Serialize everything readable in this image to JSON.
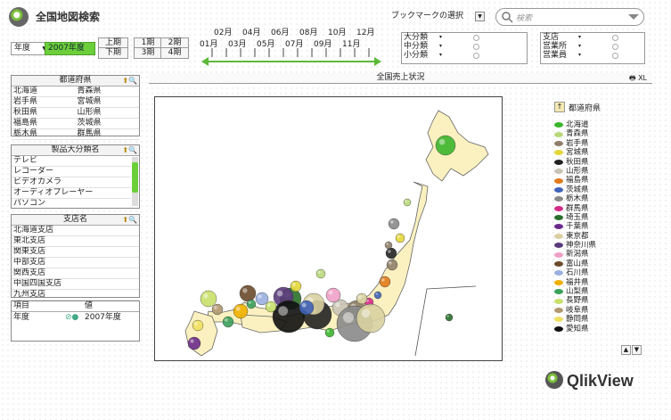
{
  "app": {
    "title": "全国地図検索",
    "bookmark_label": "ブックマークの選択",
    "search_placeholder": "検索",
    "brand": "QlikView"
  },
  "period": {
    "year_label": "年度",
    "year_value": "2007年度",
    "half_upper": "上期",
    "half_lower": "下期",
    "q1": "1期",
    "q2": "2期",
    "q3": "3期",
    "q4": "4期",
    "months_top": [
      "02月",
      "04月",
      "06月",
      "08月",
      "10月",
      "12月"
    ],
    "months_bottom": [
      "01月",
      "03月",
      "05月",
      "07月",
      "09月",
      "11月"
    ]
  },
  "filters_left": [
    {
      "label": "大分類"
    },
    {
      "label": "中分類"
    },
    {
      "label": "小分類"
    }
  ],
  "filters_right": [
    {
      "label": "支店"
    },
    {
      "label": "営業所"
    },
    {
      "label": "営業員"
    }
  ],
  "prefecture_panel": {
    "title": "都道府県",
    "rows": [
      [
        "北海道",
        "青森県"
      ],
      [
        "岩手県",
        "宮城県"
      ],
      [
        "秋田県",
        "山形県"
      ],
      [
        "福島県",
        "茨城県"
      ],
      [
        "栃木県",
        "群馬県"
      ]
    ]
  },
  "category_panel": {
    "title": "製品大分類名",
    "items": [
      "テレビ",
      "レコーダー",
      "ビデオカメラ",
      "オーディオプレーヤー",
      "パソコン"
    ]
  },
  "branch_panel": {
    "title": "支店名",
    "items": [
      "北海道支店",
      "東北支店",
      "関東支店",
      "中部支店",
      "関西支店",
      "中国四国支店",
      "九州支店"
    ]
  },
  "selection_panel": {
    "col_item": "項目",
    "col_value": "値",
    "row_item": "年度",
    "row_value": "2007年度"
  },
  "map": {
    "title": "全国売上状況",
    "xl_label": "XL"
  },
  "legend": {
    "title": "都道府県",
    "entries": [
      {
        "name": "北海道",
        "color": "#3bb52c"
      },
      {
        "name": "青森県",
        "color": "#b9d87a"
      },
      {
        "name": "岩手県",
        "color": "#8f7f6a"
      },
      {
        "name": "宮城県",
        "color": "#e3d63a"
      },
      {
        "name": "秋田県",
        "color": "#222222"
      },
      {
        "name": "山形県",
        "color": "#c8c3b6"
      },
      {
        "name": "福島県",
        "color": "#e07a1c"
      },
      {
        "name": "茨城県",
        "color": "#3f63b8"
      },
      {
        "name": "栃木県",
        "color": "#8a8a8a"
      },
      {
        "name": "群馬県",
        "color": "#d62a8a"
      },
      {
        "name": "埼玉県",
        "color": "#2a6f2a"
      },
      {
        "name": "千葉県",
        "color": "#6a2a8a"
      },
      {
        "name": "東京都",
        "color": "#d8d0a0"
      },
      {
        "name": "神奈川県",
        "color": "#5a3a7a"
      },
      {
        "name": "新潟県",
        "color": "#f0a0c8"
      },
      {
        "name": "富山県",
        "color": "#6a4a2a"
      },
      {
        "name": "石川県",
        "color": "#9ab0e0"
      },
      {
        "name": "福井県",
        "color": "#f0b000"
      },
      {
        "name": "山梨県",
        "color": "#3aa05a"
      },
      {
        "name": "長野県",
        "color": "#c8e06a"
      },
      {
        "name": "岐阜県",
        "color": "#b09870"
      },
      {
        "name": "静岡県",
        "color": "#f0e060"
      },
      {
        "name": "愛知県",
        "color": "#111111"
      }
    ]
  }
}
